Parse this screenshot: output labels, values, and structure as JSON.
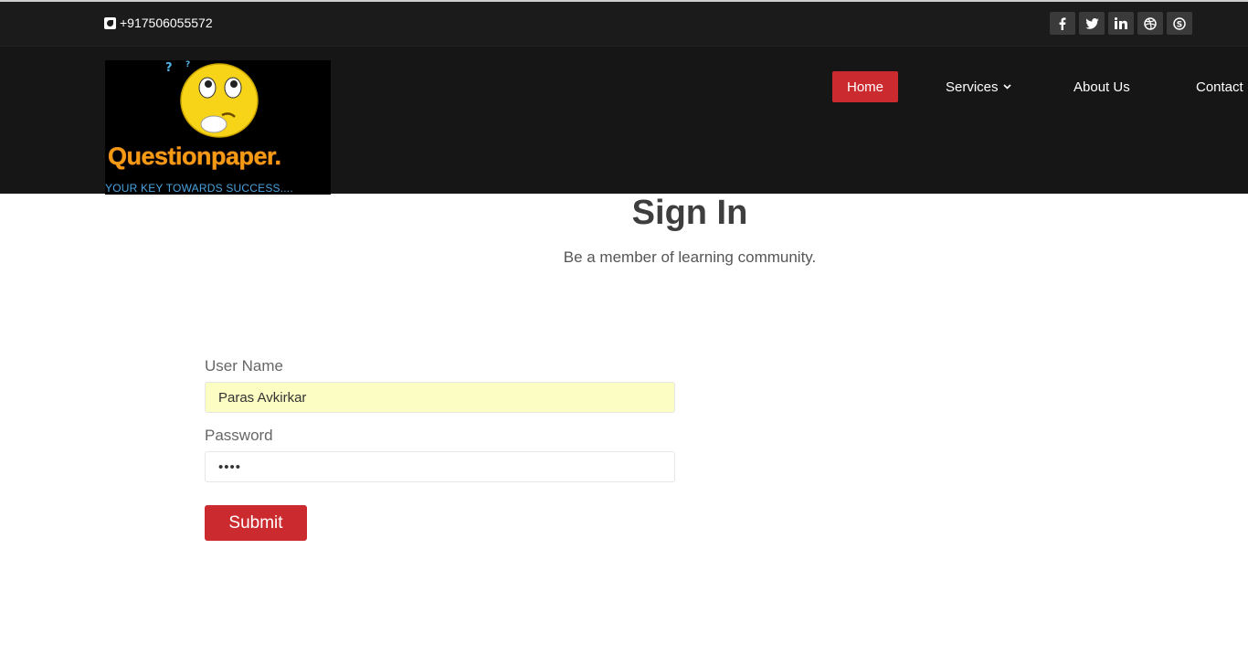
{
  "topbar": {
    "phone": "+917506055572",
    "social": [
      {
        "icon": "facebook-icon"
      },
      {
        "icon": "twitter-icon"
      },
      {
        "icon": "linkedin-icon"
      },
      {
        "icon": "dribbble-icon"
      },
      {
        "icon": "skype-icon"
      }
    ]
  },
  "logo": {
    "name": "Questionpaper.",
    "tagline": "YOUR KEY TOWARDS SUCCESS...."
  },
  "nav": {
    "home": "Home",
    "services": "Services",
    "about": "About Us",
    "contact": "Contact"
  },
  "page": {
    "title": "Sign In",
    "subtitle": "Be a member of learning community."
  },
  "form": {
    "username_label": "User Name",
    "username_value": "Paras Avkirkar",
    "password_label": "Password",
    "password_value": "••••",
    "submit_label": "Submit"
  },
  "colors": {
    "accent": "#cb2a2f",
    "header_bg": "#161616",
    "autofill_bg": "#fbfdc2"
  }
}
